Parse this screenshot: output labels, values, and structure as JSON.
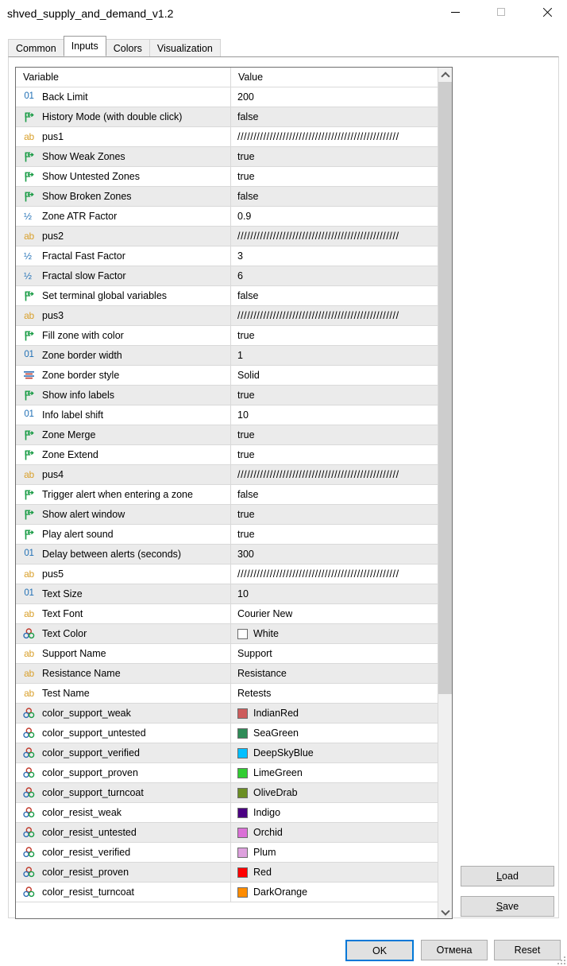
{
  "window": {
    "title": "shved_supply_and_demand_v1.2",
    "minimize_label": "minimize",
    "maximize_label": "maximize",
    "close_label": "close"
  },
  "tabs": [
    {
      "label": "Common",
      "active": false
    },
    {
      "label": "Inputs",
      "active": true
    },
    {
      "label": "Colors",
      "active": false
    },
    {
      "label": "Visualization",
      "active": false
    }
  ],
  "grid": {
    "headers": {
      "variable": "Variable",
      "value": "Value"
    },
    "separator_text": "//////////////////////////////////////////////////",
    "rows": [
      {
        "icon": "int",
        "variable": "Back Limit",
        "value": "200"
      },
      {
        "icon": "bool",
        "variable": "History Mode (with double click)",
        "value": "false"
      },
      {
        "icon": "str",
        "variable": "pus1",
        "value": "//////////////////////////////////////////////////"
      },
      {
        "icon": "bool",
        "variable": "Show Weak Zones",
        "value": "true"
      },
      {
        "icon": "bool",
        "variable": "Show Untested Zones",
        "value": "true"
      },
      {
        "icon": "bool",
        "variable": "Show Broken Zones",
        "value": "false"
      },
      {
        "icon": "dbl",
        "variable": "Zone ATR Factor",
        "value": "0.9"
      },
      {
        "icon": "str",
        "variable": "pus2",
        "value": "//////////////////////////////////////////////////"
      },
      {
        "icon": "dbl",
        "variable": "Fractal Fast Factor",
        "value": "3"
      },
      {
        "icon": "dbl",
        "variable": "Fractal slow Factor",
        "value": "6"
      },
      {
        "icon": "bool",
        "variable": "Set terminal global variables",
        "value": "false"
      },
      {
        "icon": "str",
        "variable": "pus3",
        "value": "//////////////////////////////////////////////////"
      },
      {
        "icon": "bool",
        "variable": "Fill zone with color",
        "value": "true"
      },
      {
        "icon": "int",
        "variable": "Zone border width",
        "value": "1"
      },
      {
        "icon": "style",
        "variable": "Zone border style",
        "value": "Solid"
      },
      {
        "icon": "bool",
        "variable": "Show info labels",
        "value": "true"
      },
      {
        "icon": "int",
        "variable": "Info label shift",
        "value": "10"
      },
      {
        "icon": "bool",
        "variable": "Zone Merge",
        "value": "true"
      },
      {
        "icon": "bool",
        "variable": "Zone Extend",
        "value": "true"
      },
      {
        "icon": "str",
        "variable": "pus4",
        "value": "//////////////////////////////////////////////////"
      },
      {
        "icon": "bool",
        "variable": "Trigger alert when entering a zone",
        "value": "false"
      },
      {
        "icon": "bool",
        "variable": "Show alert window",
        "value": "true"
      },
      {
        "icon": "bool",
        "variable": "Play alert sound",
        "value": "true"
      },
      {
        "icon": "int",
        "variable": "Delay between alerts (seconds)",
        "value": "300"
      },
      {
        "icon": "str",
        "variable": "pus5",
        "value": "//////////////////////////////////////////////////"
      },
      {
        "icon": "int",
        "variable": "Text Size",
        "value": "10"
      },
      {
        "icon": "str",
        "variable": "Text Font",
        "value": "Courier New"
      },
      {
        "icon": "color",
        "variable": "Text Color",
        "value": "White",
        "swatch": "#ffffff"
      },
      {
        "icon": "str",
        "variable": "Support Name",
        "value": "Support"
      },
      {
        "icon": "str",
        "variable": "Resistance Name",
        "value": "Resistance"
      },
      {
        "icon": "str",
        "variable": "Test Name",
        "value": "Retests"
      },
      {
        "icon": "color",
        "variable": "color_support_weak",
        "value": "IndianRed",
        "swatch": "#cd5c5c"
      },
      {
        "icon": "color",
        "variable": "color_support_untested",
        "value": "SeaGreen",
        "swatch": "#2e8b57"
      },
      {
        "icon": "color",
        "variable": "color_support_verified",
        "value": "DeepSkyBlue",
        "swatch": "#00bfff"
      },
      {
        "icon": "color",
        "variable": "color_support_proven",
        "value": "LimeGreen",
        "swatch": "#32cd32"
      },
      {
        "icon": "color",
        "variable": "color_support_turncoat",
        "value": "OliveDrab",
        "swatch": "#6b8e23"
      },
      {
        "icon": "color",
        "variable": "color_resist_weak",
        "value": "Indigo",
        "swatch": "#4b0082"
      },
      {
        "icon": "color",
        "variable": "color_resist_untested",
        "value": "Orchid",
        "swatch": "#da70d6"
      },
      {
        "icon": "color",
        "variable": "color_resist_verified",
        "value": "Plum",
        "swatch": "#dda0dd"
      },
      {
        "icon": "color",
        "variable": "color_resist_proven",
        "value": "Red",
        "swatch": "#ff0000"
      },
      {
        "icon": "color",
        "variable": "color_resist_turncoat",
        "value": "DarkOrange",
        "swatch": "#ff8c00"
      }
    ]
  },
  "side_buttons": {
    "load": {
      "mnemonic": "L",
      "rest": "oad"
    },
    "save": {
      "mnemonic": "S",
      "rest": "ave"
    }
  },
  "bottom_buttons": {
    "ok": "OK",
    "cancel": "Отмена",
    "reset": "Reset"
  },
  "icon_names": {
    "int": "integer-type-icon",
    "bool": "boolean-flag-icon",
    "str": "string-type-icon",
    "dbl": "double-type-icon",
    "style": "line-style-icon",
    "color": "color-type-icon"
  }
}
